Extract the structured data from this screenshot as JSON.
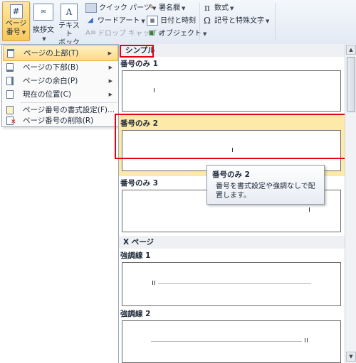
{
  "ribbon": {
    "page_number": {
      "line1": "ページ",
      "line2": "番号"
    },
    "greeting": {
      "label": "挨拶文"
    },
    "textbox": {
      "line1": "テキスト",
      "line2": "ボックス"
    },
    "quick_parts": "クイック パーツ",
    "wordart": "ワードアート",
    "drop_cap": "ドロップ キャップ",
    "signature": "署名欄",
    "datetime": "日付と時刻",
    "object": "オブジェクト",
    "equation": "数式",
    "symbol": "記号と特殊文字"
  },
  "menu": {
    "items": [
      {
        "label": "ページの上部(T)"
      },
      {
        "label": "ページの下部(B)"
      },
      {
        "label": "ページの余白(P)"
      },
      {
        "label": "現在の位置(C)"
      },
      {
        "label": "ページ番号の書式設定(F)..."
      },
      {
        "label": "ページ番号の削除(R)"
      }
    ]
  },
  "gallery": {
    "sections": [
      {
        "heading": "シンプル"
      },
      {
        "heading": "X ページ"
      }
    ],
    "items": [
      {
        "label": "番号のみ 1"
      },
      {
        "label": "番号のみ 2"
      },
      {
        "label": "番号のみ 3"
      },
      {
        "label": "強調線 1"
      },
      {
        "label": "強調線 2"
      }
    ]
  },
  "tooltip": {
    "title": "番号のみ 2",
    "body": "番号を書式設定や強調なしで配置します。"
  },
  "colors": {
    "highlight": "#fdeaa8",
    "callout": "#e60012"
  }
}
